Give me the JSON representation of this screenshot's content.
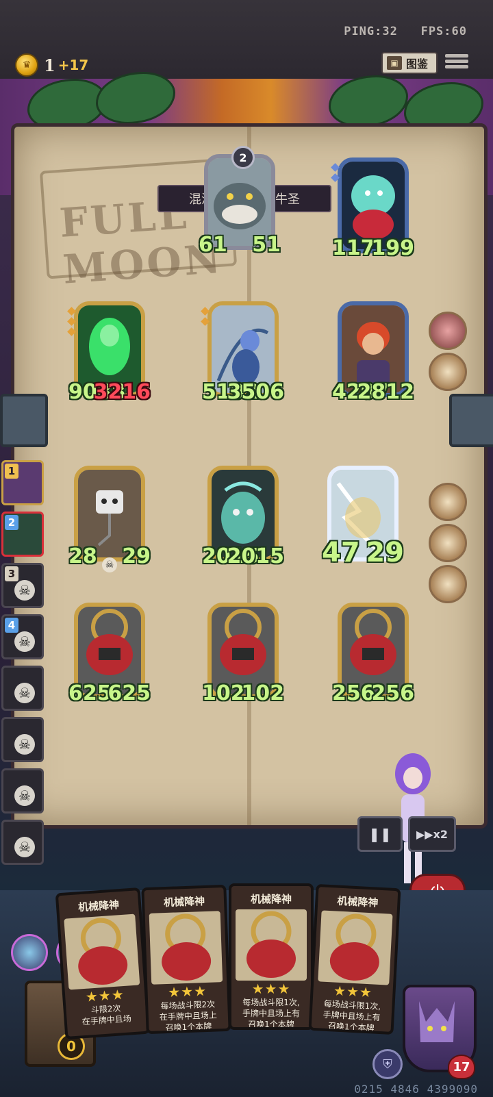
{
  "topbar": {
    "ping": "PING:32",
    "fps": "FPS:60",
    "gold": "1",
    "gold_delta": "+17",
    "codex_label": "图鉴"
  },
  "board": {
    "title": "混沌撼岳诛仙蛮牛圣",
    "background_text": "FULL MOON",
    "units": [
      {
        "atk": "61",
        "hp": "51",
        "level": "2"
      },
      {
        "atk": "117",
        "hp": "199"
      },
      {
        "atk": "9088",
        "hp": "3216"
      },
      {
        "atk": "5192",
        "hp": "3506"
      },
      {
        "atk": "4207",
        "hp": "2812"
      },
      {
        "atk": "28",
        "hp": "29"
      },
      {
        "atk": "2015",
        "hp": "2015"
      },
      {
        "atk": "47",
        "hp": "29"
      },
      {
        "atk": "625",
        "hp": "625"
      },
      {
        "atk": "102",
        "hp": "102"
      },
      {
        "atk": "256",
        "hp": "256"
      }
    ]
  },
  "roster": [
    {
      "rank": "1"
    },
    {
      "rank": "2"
    },
    {
      "rank": "3"
    },
    {
      "rank": "4"
    },
    {
      "rank": ""
    },
    {
      "rank": ""
    },
    {
      "rank": ""
    },
    {
      "rank": ""
    }
  ],
  "controls": {
    "speed_label": "x2"
  },
  "hand": {
    "cards": [
      {
        "title": "机械降神",
        "text": "斗限2次\n在手牌中且场"
      },
      {
        "title": "机械降神",
        "text": "每场战斗限2次\n在手牌中且场上\n召唤1个本牌"
      },
      {
        "title": "机械降神",
        "text": "每场战斗限1次,\n手牌中且场上有\n召唤1个本牌"
      },
      {
        "title": "机械降神",
        "text": "每场战斗限1次,\n手牌中且场上有\n召唤1个本牌"
      }
    ],
    "chest_count": "0",
    "health": "17"
  },
  "footer": {
    "match_id": "0215 4846 4399090"
  }
}
